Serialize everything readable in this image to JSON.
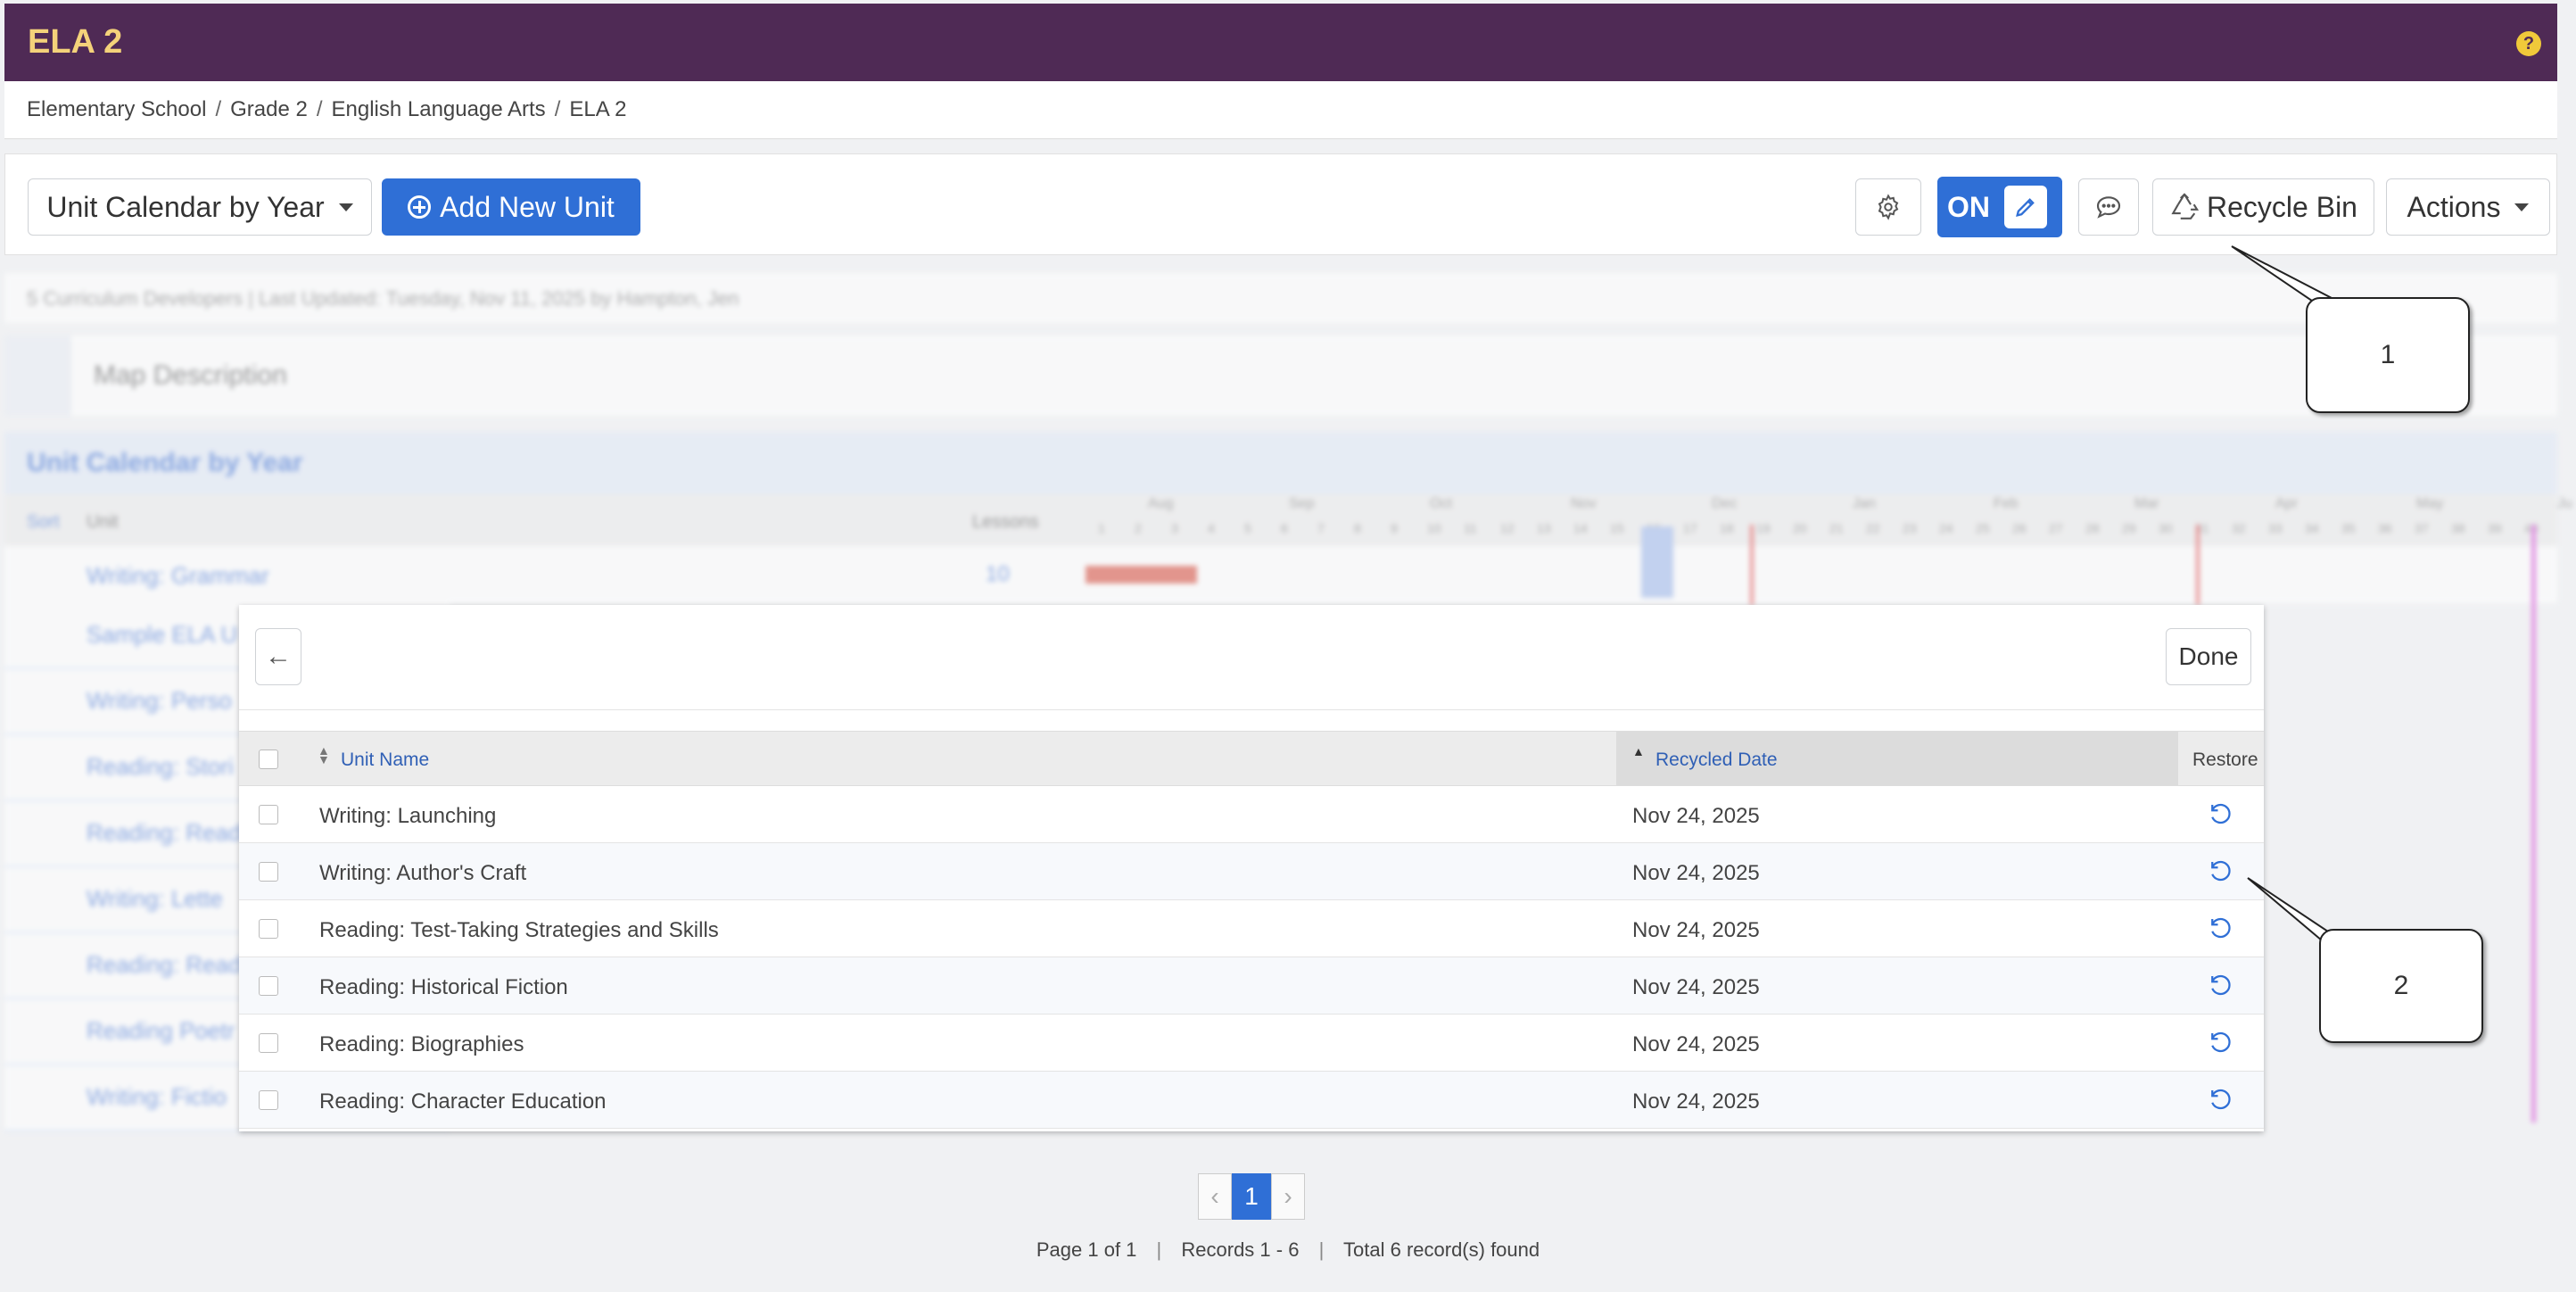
{
  "header": {
    "title": "ELA 2",
    "help": "?"
  },
  "breadcrumb": [
    "Elementary School",
    "Grade 2",
    "English Language Arts",
    "ELA 2"
  ],
  "toolbar": {
    "view_select": "Unit Calendar by Year",
    "add_unit": "Add New Unit",
    "toggle": "ON",
    "recycle_bin": "Recycle Bin",
    "actions": "Actions"
  },
  "background": {
    "meta": "5 Curriculum Developers | Last Updated: Tuesday, Nov 11, 2025 by Hampton, Jen",
    "map_description": "Map Description",
    "section_title": "Unit Calendar by Year",
    "col_sort": "Sort",
    "col_unit": "Unit",
    "col_lessons": "Lessons",
    "first_unit": "Writing: Grammar",
    "first_lessons": "10",
    "months": [
      "Aug",
      "Sep",
      "Oct",
      "Nov",
      "Dec",
      "Jan",
      "Feb",
      "Mar",
      "Apr",
      "May",
      "Ju"
    ],
    "weeks": [
      "1",
      "2",
      "3",
      "4",
      "5",
      "6",
      "7",
      "8",
      "9",
      "10",
      "11",
      "12",
      "13",
      "14",
      "15",
      "16",
      "17",
      "18",
      "19",
      "20",
      "21",
      "22",
      "23",
      "24",
      "25",
      "26",
      "27",
      "28",
      "29",
      "30",
      "31",
      "32",
      "33",
      "34",
      "35",
      "36",
      "37",
      "38",
      "39",
      "40"
    ],
    "unit_fragments": [
      "Sample ELA U",
      "Writing: Perso",
      "Reading: Stori",
      "Reading: Read",
      "Writing: Lette",
      "Reading: Read",
      "Reading Poetr",
      "Writing: Fictio"
    ]
  },
  "recycle": {
    "back": "←",
    "done": "Done",
    "columns": {
      "name": "Unit Name",
      "date": "Recycled Date",
      "restore": "Restore"
    },
    "rows": [
      {
        "name": "Writing: Launching",
        "date": "Nov 24, 2025"
      },
      {
        "name": "Writing: Author's Craft",
        "date": "Nov 24, 2025"
      },
      {
        "name": "Reading: Test-Taking Strategies and Skills",
        "date": "Nov 24, 2025"
      },
      {
        "name": "Reading: Historical Fiction",
        "date": "Nov 24, 2025"
      },
      {
        "name": "Reading: Biographies",
        "date": "Nov 24, 2025"
      },
      {
        "name": "Reading: Character Education",
        "date": "Nov 24, 2025"
      }
    ]
  },
  "pagination": {
    "prev": "‹",
    "current": "1",
    "next": "›",
    "page_info": "Page 1 of 1",
    "records": "Records 1 - 6",
    "total": "Total 6 record(s) found"
  },
  "callouts": [
    "1",
    "2"
  ]
}
